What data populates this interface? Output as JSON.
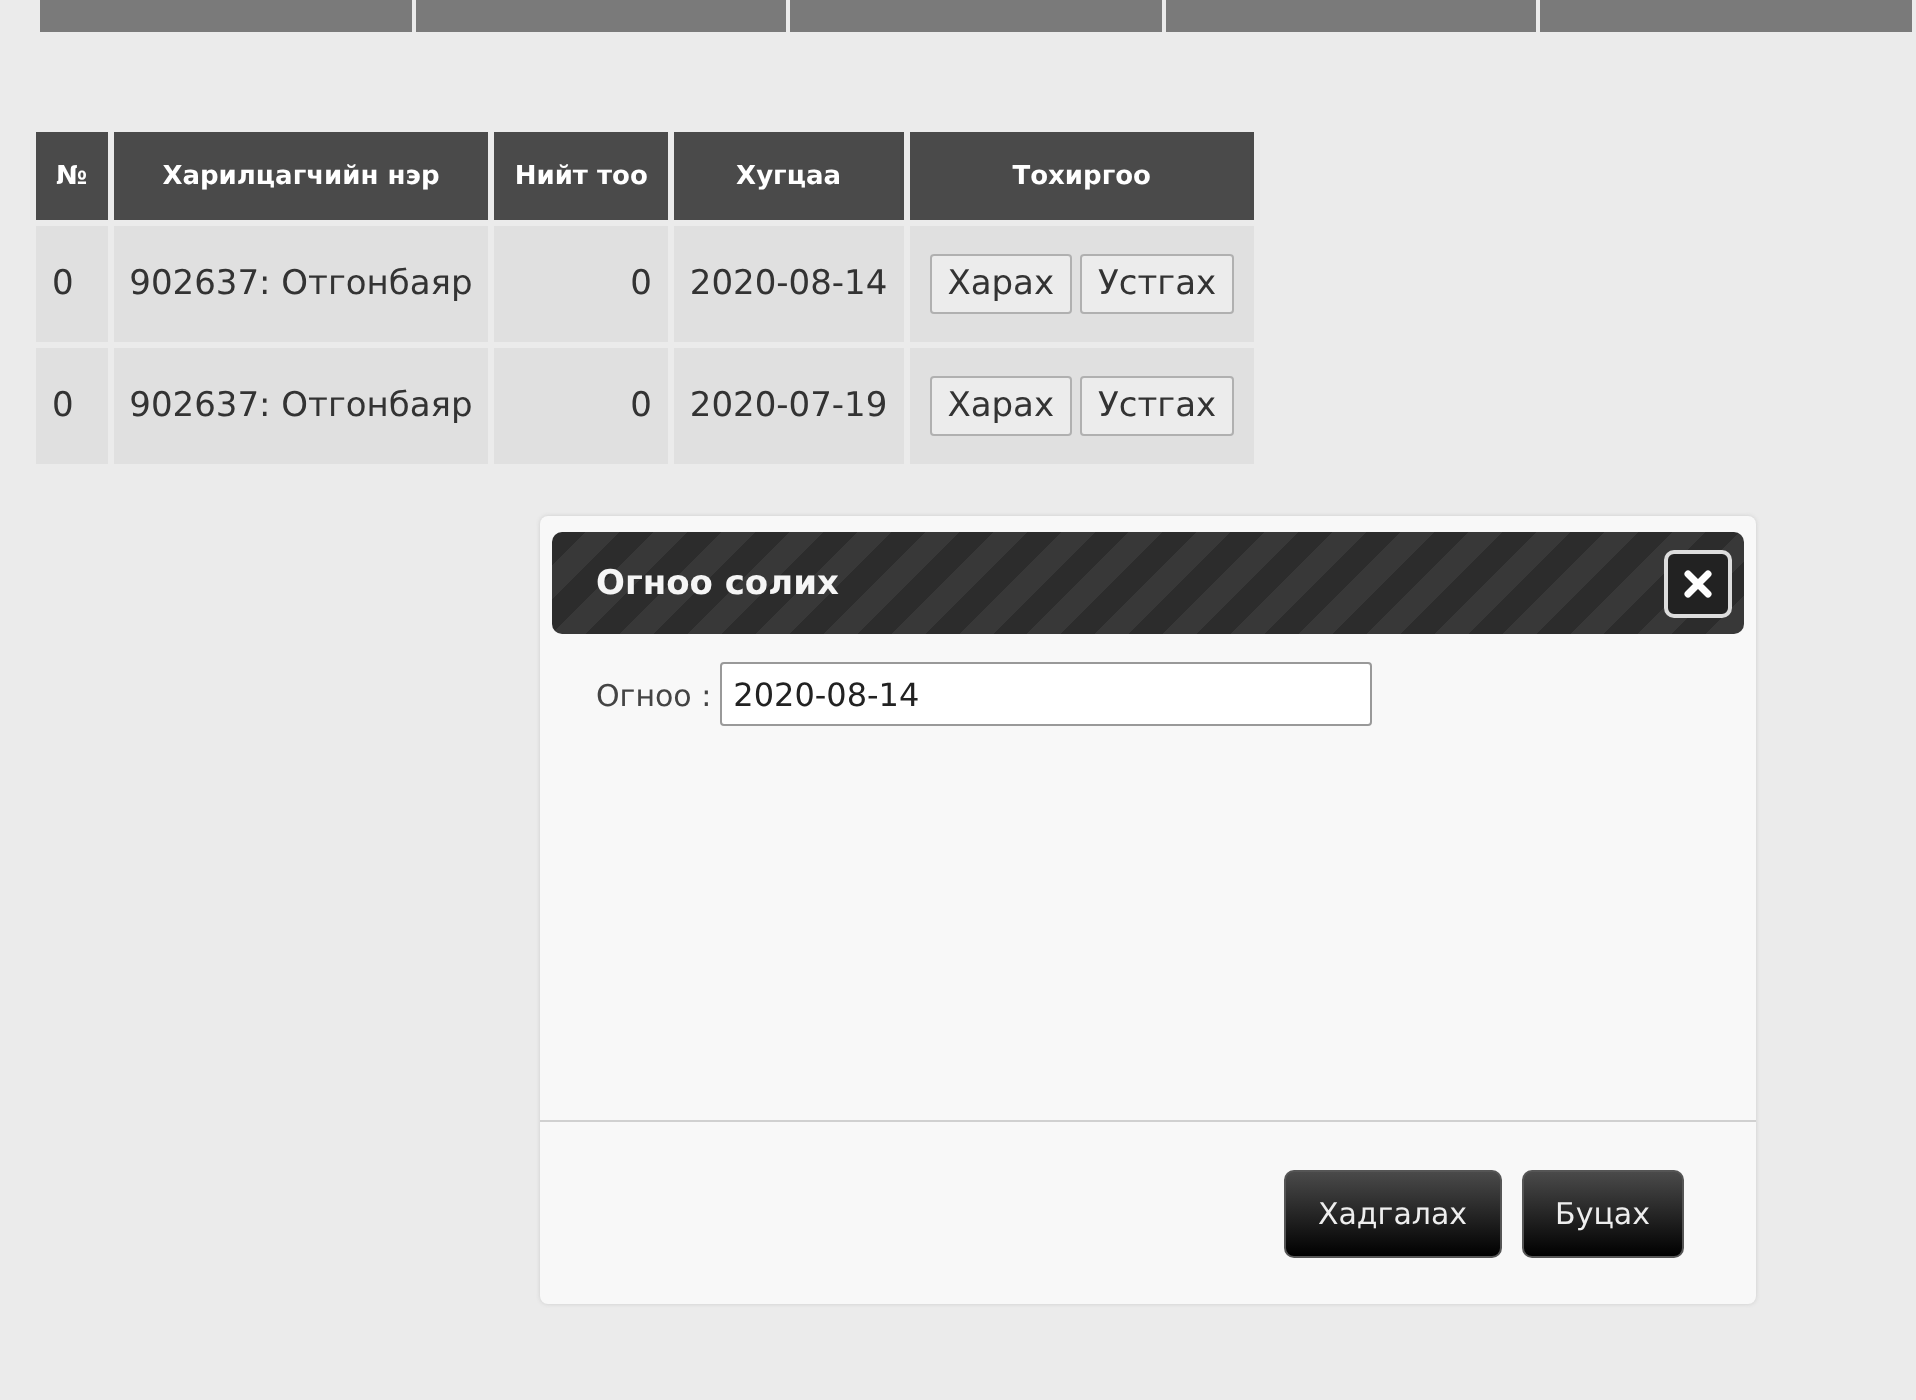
{
  "table": {
    "columns": [
      "№",
      "Харилцагчийн нэр",
      "Нийт тоо",
      "Хугцаа",
      "Тохиргоо"
    ],
    "rows": [
      {
        "no": "0",
        "name": "902637: Отгонбаяр",
        "total": "0",
        "date": "2020-08-14",
        "actions": [
          "Харах",
          "Устгах"
        ]
      },
      {
        "no": "0",
        "name": "902637: Отгонбаяр",
        "total": "0",
        "date": "2020-07-19",
        "actions": [
          "Харах",
          "Устгах"
        ]
      }
    ]
  },
  "dialog": {
    "title": "Огноо солих",
    "field_label": "Огноо :",
    "field_value": "2020-08-14",
    "buttons": [
      "Хадгалах",
      "Буцах"
    ]
  }
}
